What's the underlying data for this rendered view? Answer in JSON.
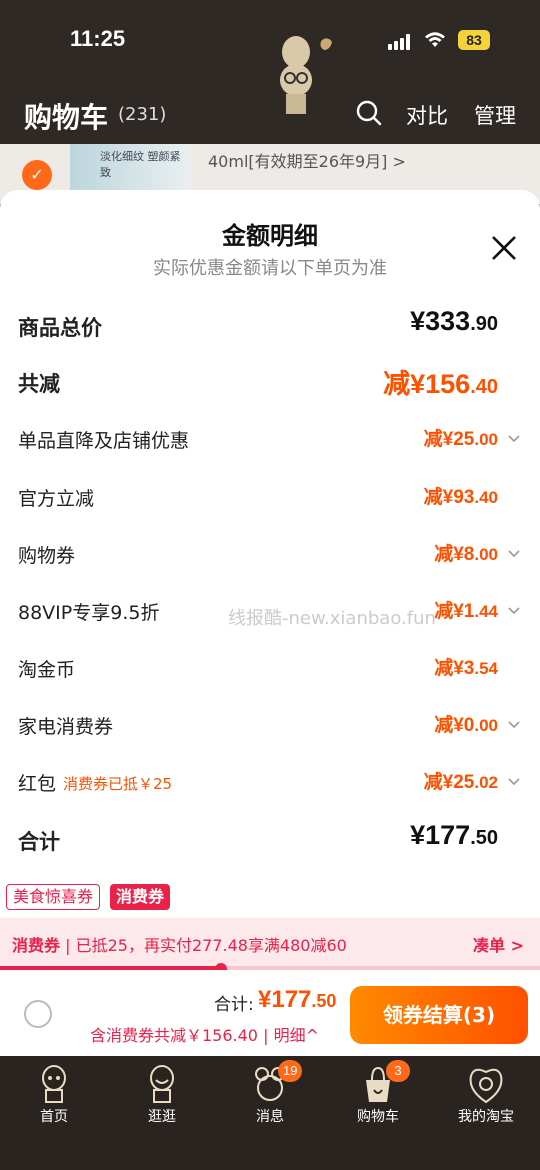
{
  "status_bar": {
    "time": "11:25",
    "battery": "83"
  },
  "header": {
    "title": "购物车",
    "count": "(231)",
    "compare": "对比",
    "manage": "管理"
  },
  "background_item": {
    "thumb_text": "淡化细纹 塑颜紧致",
    "desc": "40ml[有效期至26年9月] >"
  },
  "sheet": {
    "title": "金额明细",
    "subtitle": "实际优惠金额请以下单页为准",
    "rows": [
      {
        "label": "商品总价",
        "int": "¥333",
        "dec": ".90"
      },
      {
        "label": "共减",
        "int": "减¥156",
        "dec": ".40"
      },
      {
        "label": "单品直降及店铺优惠",
        "int": "减¥25",
        "dec": ".00"
      },
      {
        "label": "官方立减",
        "int": "减¥93",
        "dec": ".40"
      },
      {
        "label": "购物券",
        "int": "减¥8",
        "dec": ".00"
      },
      {
        "label": "88VIP专享9.5折",
        "int": "减¥1",
        "dec": ".44"
      },
      {
        "label": "淘金币",
        "int": "减¥3",
        "dec": ".54"
      },
      {
        "label": "家电消费券",
        "int": "减¥0",
        "dec": ".00"
      },
      {
        "label": "红包",
        "sublabel": "消费券已抵￥25",
        "int": "减¥25",
        "dec": ".02"
      },
      {
        "label": "合计",
        "int": "¥177",
        "dec": ".50"
      }
    ]
  },
  "watermark": "线报酷-new.xianbao.fun",
  "tags": {
    "tag1": "美食惊喜券",
    "tag2": "消费券"
  },
  "promo": {
    "text_bold": "消费券",
    "text": "已抵25，再实付277.48享满480减60",
    "link": "凑单 >",
    "progress": 0.41
  },
  "checkout": {
    "total_label": "合计:",
    "total_int": "¥177",
    "total_dec": ".50",
    "sub": "含消费券共减￥156.40",
    "detail": "明细^",
    "button": "领券结算(3)"
  },
  "tabs": [
    {
      "label": "首页",
      "icon": "home-icon"
    },
    {
      "label": "逛逛",
      "icon": "browse-icon"
    },
    {
      "label": "消息",
      "icon": "message-icon",
      "badge": "19"
    },
    {
      "label": "购物车",
      "icon": "cart-icon",
      "badge": "3"
    },
    {
      "label": "我的淘宝",
      "icon": "profile-icon"
    }
  ],
  "colors": {
    "accent": "#ff5000",
    "promo_red": "#e8224a",
    "header_bg": "#2f2925"
  }
}
